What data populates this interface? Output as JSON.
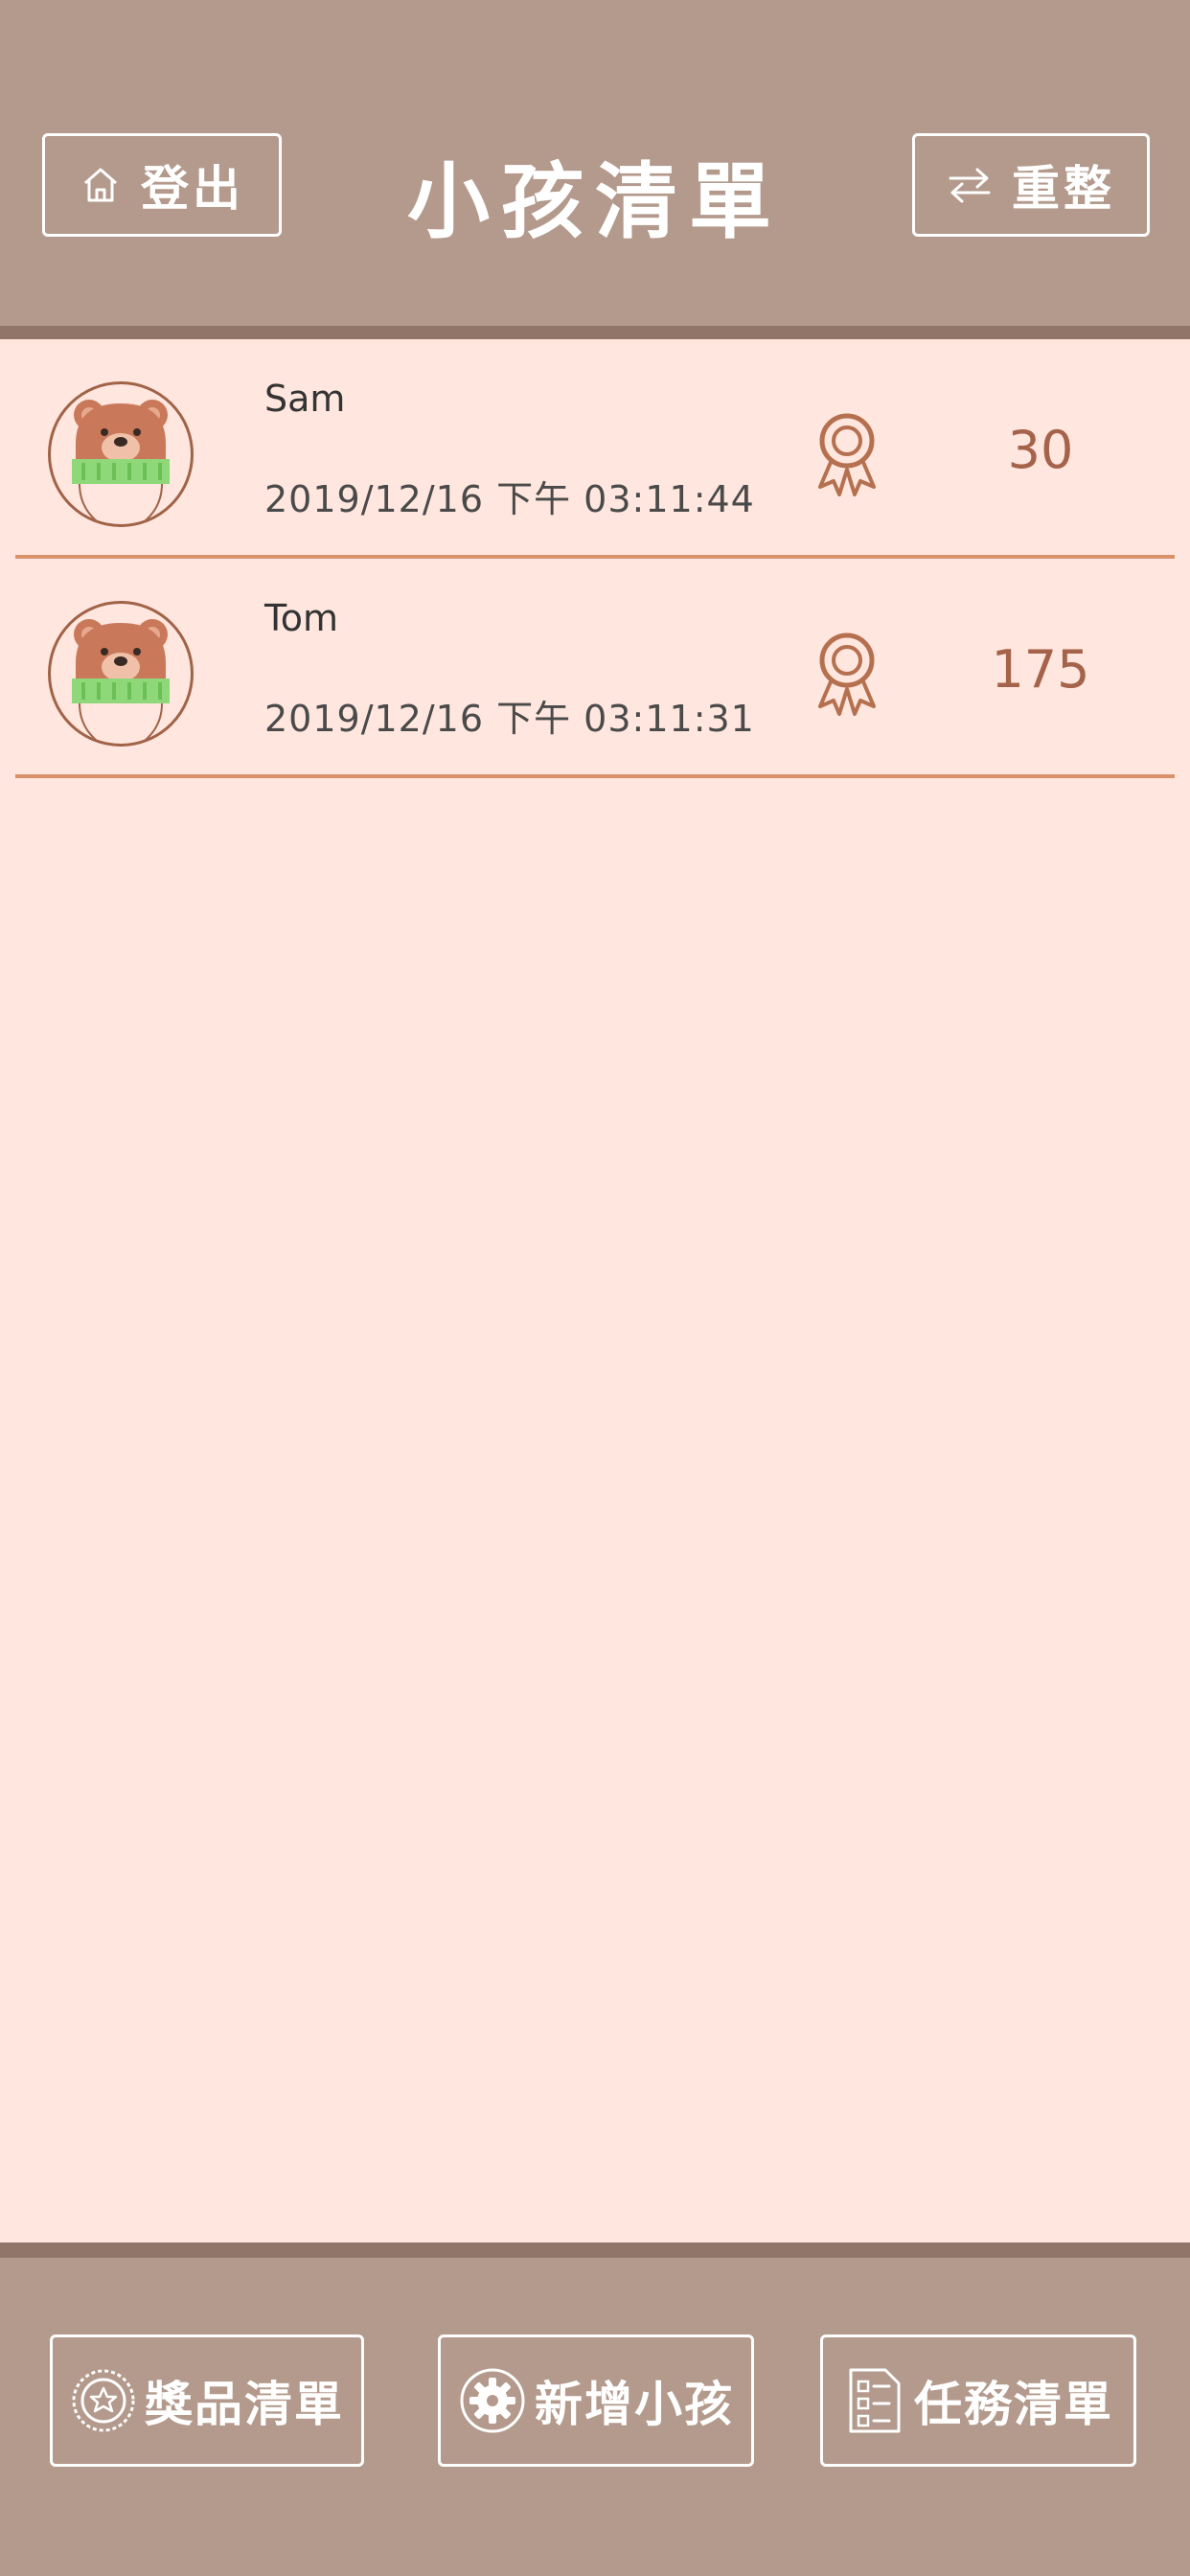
{
  "header": {
    "title": "小孩清單",
    "logout_label": "登出",
    "reset_label": "重整"
  },
  "children": [
    {
      "name": "Sam",
      "time": "2019/12/16 下午 03:11:44",
      "points": "30"
    },
    {
      "name": "Tom",
      "time": "2019/12/16 下午 03:11:31",
      "points": "175"
    }
  ],
  "footer": {
    "prizes_label": "獎品清單",
    "add_child_label": "新增小孩",
    "tasks_label": "任務清單"
  },
  "colors": {
    "header_bg": "#b39a8c",
    "page_bg": "#ffe6de",
    "accent": "#a4634a",
    "divider": "#d9916c"
  },
  "icons": {
    "logout": "home-icon",
    "reset": "swap-arrows-icon",
    "award": "award-ribbon-icon",
    "prizes": "star-badge-icon",
    "add_child": "gear-icon",
    "tasks": "checklist-icon",
    "avatar": "bear-avatar"
  }
}
